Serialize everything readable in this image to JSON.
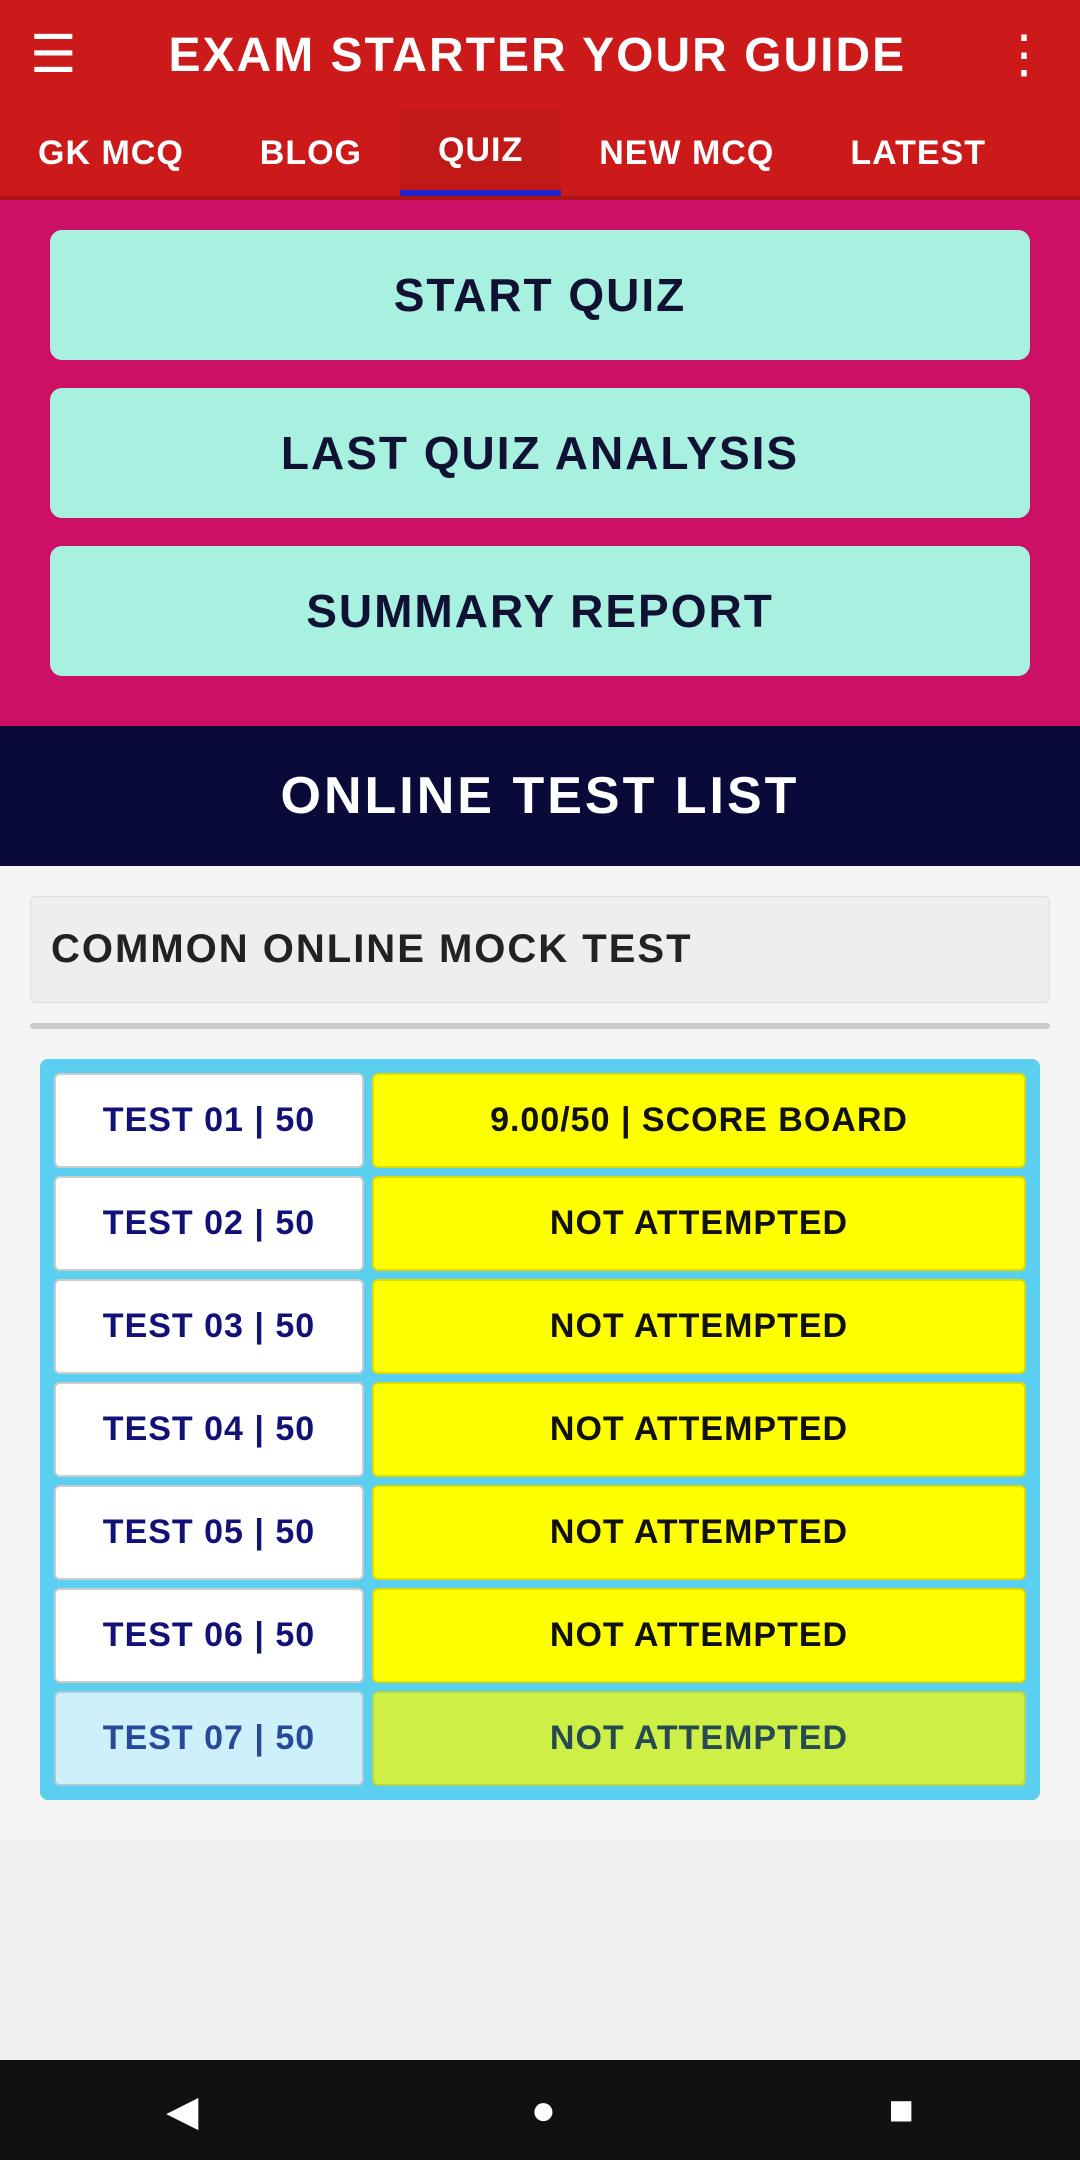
{
  "header": {
    "title": "EXAM STARTER YOUR GUIDE",
    "menu_icon": "☰",
    "dots_icon": "⋮"
  },
  "nav": {
    "tabs": [
      {
        "id": "gk-mcq",
        "label": "GK MCQ",
        "active": false
      },
      {
        "id": "blog",
        "label": "BLOG",
        "active": false
      },
      {
        "id": "quiz",
        "label": "QUIZ",
        "active": true
      },
      {
        "id": "new-mcq",
        "label": "NEW MCQ",
        "active": false
      },
      {
        "id": "latest",
        "label": "LATEST",
        "active": false
      }
    ]
  },
  "quiz_buttons": [
    {
      "id": "start-quiz",
      "label": "START QUIZ"
    },
    {
      "id": "last-quiz-analysis",
      "label": "LAST QUIZ ANALYSIS"
    },
    {
      "id": "summary-report",
      "label": "SUMMARY REPORT"
    }
  ],
  "test_list": {
    "header": "ONLINE TEST LIST",
    "section_title": "COMMON ONLINE MOCK TEST",
    "tests": [
      {
        "id": "test-01",
        "label": "TEST 01 | 50",
        "status": "9.00/50 | SCORE BOARD",
        "attempted": true
      },
      {
        "id": "test-02",
        "label": "TEST 02 | 50",
        "status": "NOT ATTEMPTED",
        "attempted": false
      },
      {
        "id": "test-03",
        "label": "TEST 03 | 50",
        "status": "NOT ATTEMPTED",
        "attempted": false
      },
      {
        "id": "test-04",
        "label": "TEST 04 | 50",
        "status": "NOT ATTEMPTED",
        "attempted": false
      },
      {
        "id": "test-05",
        "label": "TEST 05 | 50",
        "status": "NOT ATTEMPTED",
        "attempted": false
      },
      {
        "id": "test-06",
        "label": "TEST 06 | 50",
        "status": "NOT ATTEMPTED",
        "attempted": false
      },
      {
        "id": "test-07",
        "label": "TEST 07 | 50",
        "status": "NOT ATTEMPTED",
        "attempted": false
      }
    ]
  },
  "bottom_nav": {
    "back_icon": "◀",
    "home_icon": "●",
    "square_icon": "■"
  }
}
